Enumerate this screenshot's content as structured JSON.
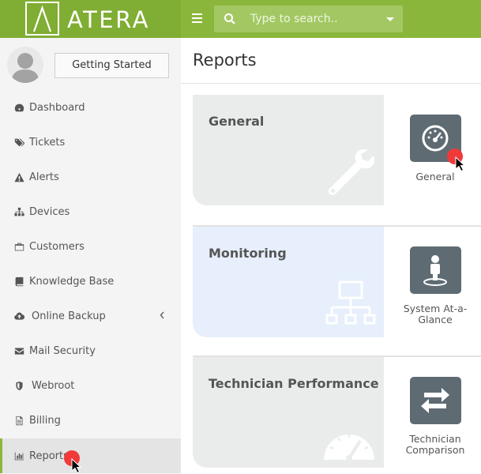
{
  "header": {
    "logo_text": "ATERA",
    "search_placeholder": "Type to search.."
  },
  "sidebar": {
    "getting_started_label": "Getting Started",
    "items": [
      {
        "label": "Dashboard",
        "icon": "dashboard-icon"
      },
      {
        "label": "Tickets",
        "icon": "tags-icon"
      },
      {
        "label": "Alerts",
        "icon": "warning-icon"
      },
      {
        "label": "Devices",
        "icon": "sitemap-icon"
      },
      {
        "label": "Customers",
        "icon": "briefcase-icon"
      },
      {
        "label": "Knowledge Base",
        "icon": "book-icon"
      },
      {
        "label": "Online Backup",
        "icon": "cloud-upload-icon"
      },
      {
        "label": "Mail Security",
        "icon": "envelope-icon"
      },
      {
        "label": "Webroot",
        "icon": "shield-icon"
      },
      {
        "label": "Billing",
        "icon": "file-icon"
      },
      {
        "label": "Reports",
        "icon": "bar-chart-icon"
      }
    ],
    "active_item": "Reports"
  },
  "main": {
    "title": "Reports",
    "sections": [
      {
        "title": "General",
        "color": "#eaecec",
        "tile": {
          "label": "General",
          "icon": "gauge-icon"
        }
      },
      {
        "title": "Monitoring",
        "color": "#e6effb",
        "tile": {
          "label": "System At-a-Glance",
          "icon": "map-marker-person-icon"
        }
      },
      {
        "title": "Technician Performance",
        "color": "#eaecec",
        "tile": {
          "label": "Technician Comparison",
          "icon": "exchange-arrows-icon"
        }
      }
    ]
  },
  "colors": {
    "brand_green": "#8ab73b",
    "tile_dark": "#5f6b73",
    "cursor_red": "#f03a3a"
  }
}
